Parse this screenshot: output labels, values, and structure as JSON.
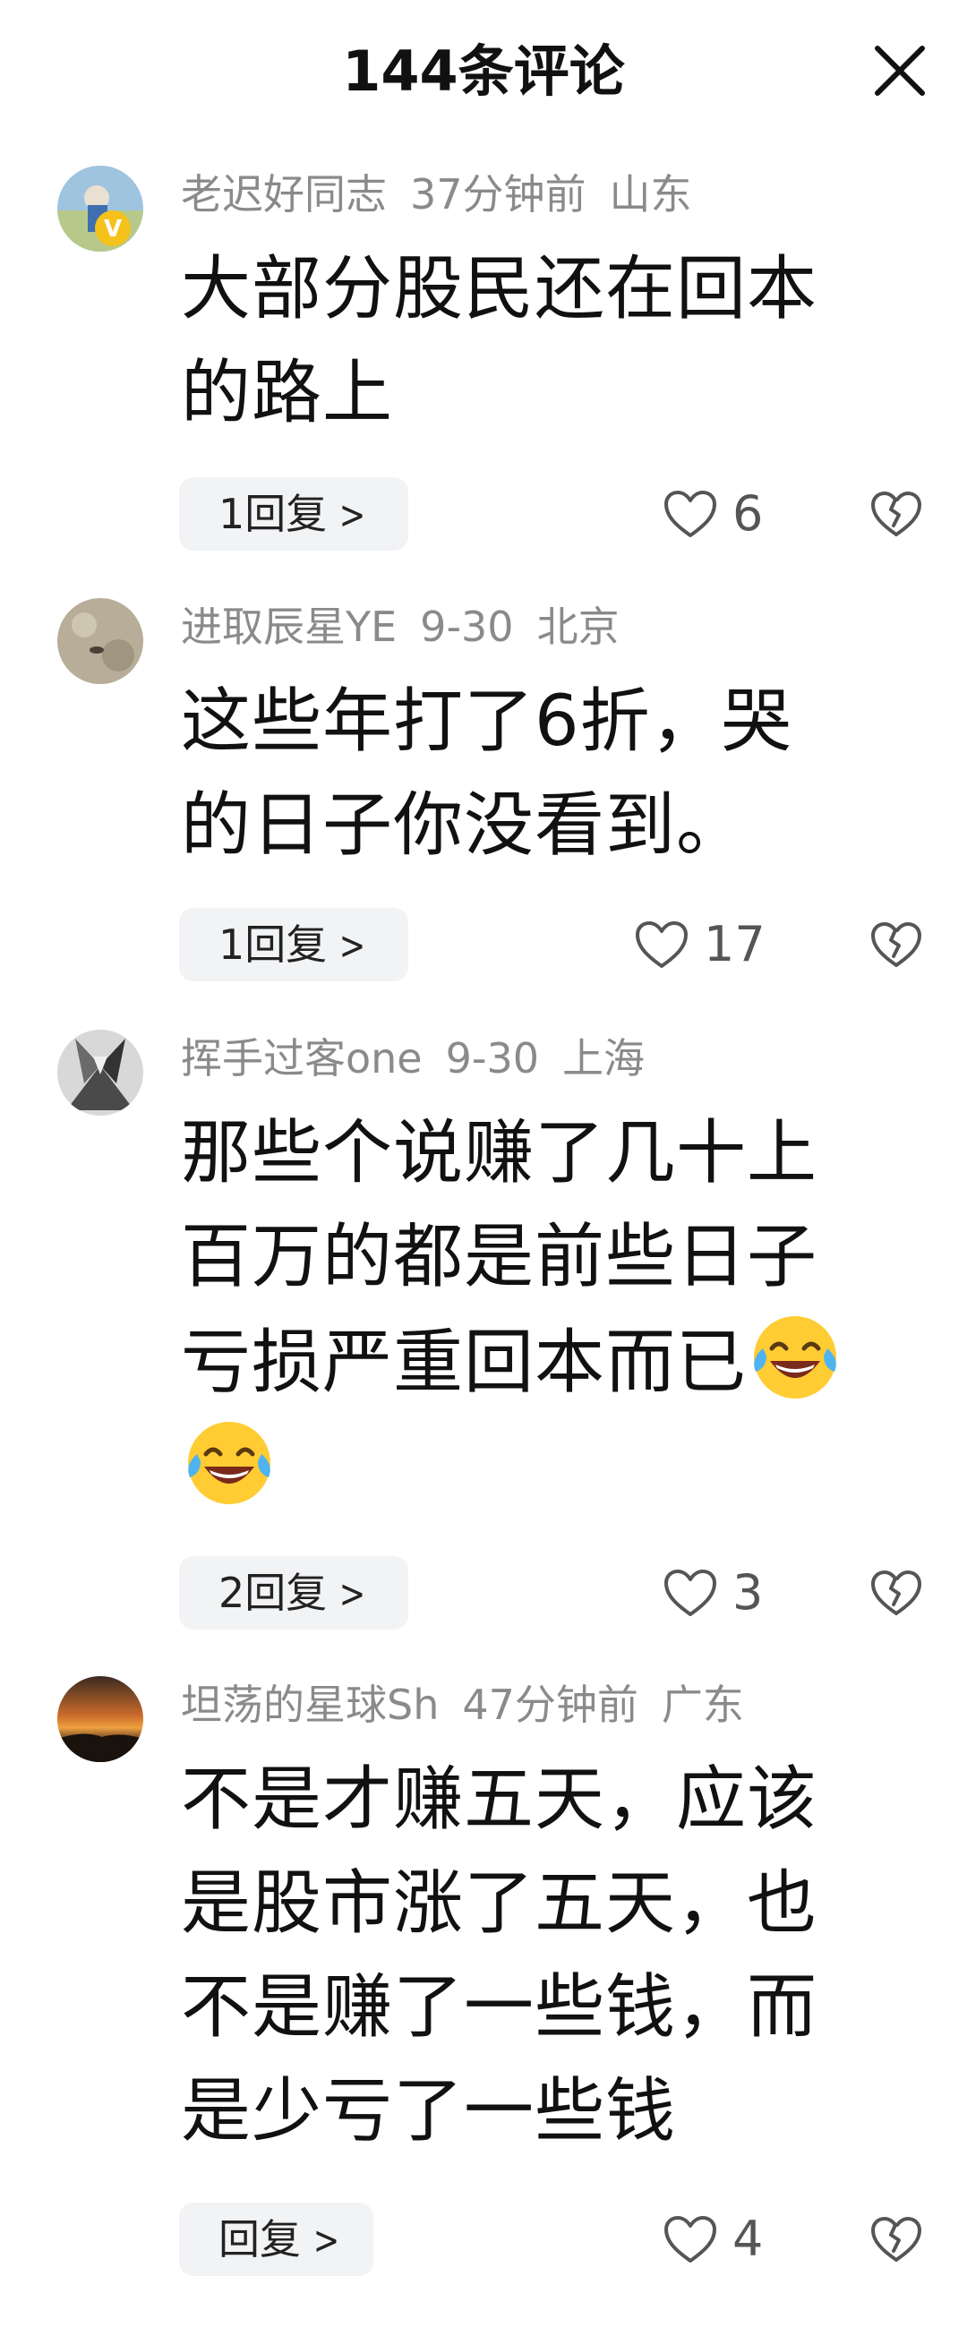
{
  "header": {
    "title": "144条评论",
    "close_icon": "close-icon"
  },
  "comments": [
    {
      "username": "老迟好同志",
      "time": "37分钟前",
      "location": "山东",
      "lines": [
        "大部分股民还在回本",
        "的路上"
      ],
      "reply_label": "1回复",
      "likes": "6",
      "avatar": "verified-user-avatar"
    },
    {
      "username": "进取辰星YE",
      "time": "9-30",
      "location": "北京",
      "lines": [
        "这些年打了6折，哭",
        "的日子你没看到。"
      ],
      "reply_label": "1回复",
      "likes": "17",
      "avatar": "sand-avatar"
    },
    {
      "username": "挥手过客one",
      "time": "9-30",
      "location": "上海",
      "lines": [
        "那些个说赚了几十上",
        "百万的都是前些日子",
        "亏损严重回本而已"
      ],
      "emoji": "tears-of-joy-emoji",
      "reply_label": "2回复",
      "likes": "3",
      "avatar": "building-avatar"
    },
    {
      "username": "坦荡的星球Sh",
      "time": "47分钟前",
      "location": "广东",
      "lines": [
        "不是才赚五天，应该",
        "是股市涨了五天，也",
        "不是赚了一些钱，而",
        "是少亏了一些钱"
      ],
      "reply_label": "回复",
      "likes": "4",
      "avatar": "sunset-avatar"
    }
  ],
  "colors": {
    "meta_text": "#8a8a8a",
    "reply_bg": "#f2f3f5",
    "icon_stroke": "#555555"
  }
}
